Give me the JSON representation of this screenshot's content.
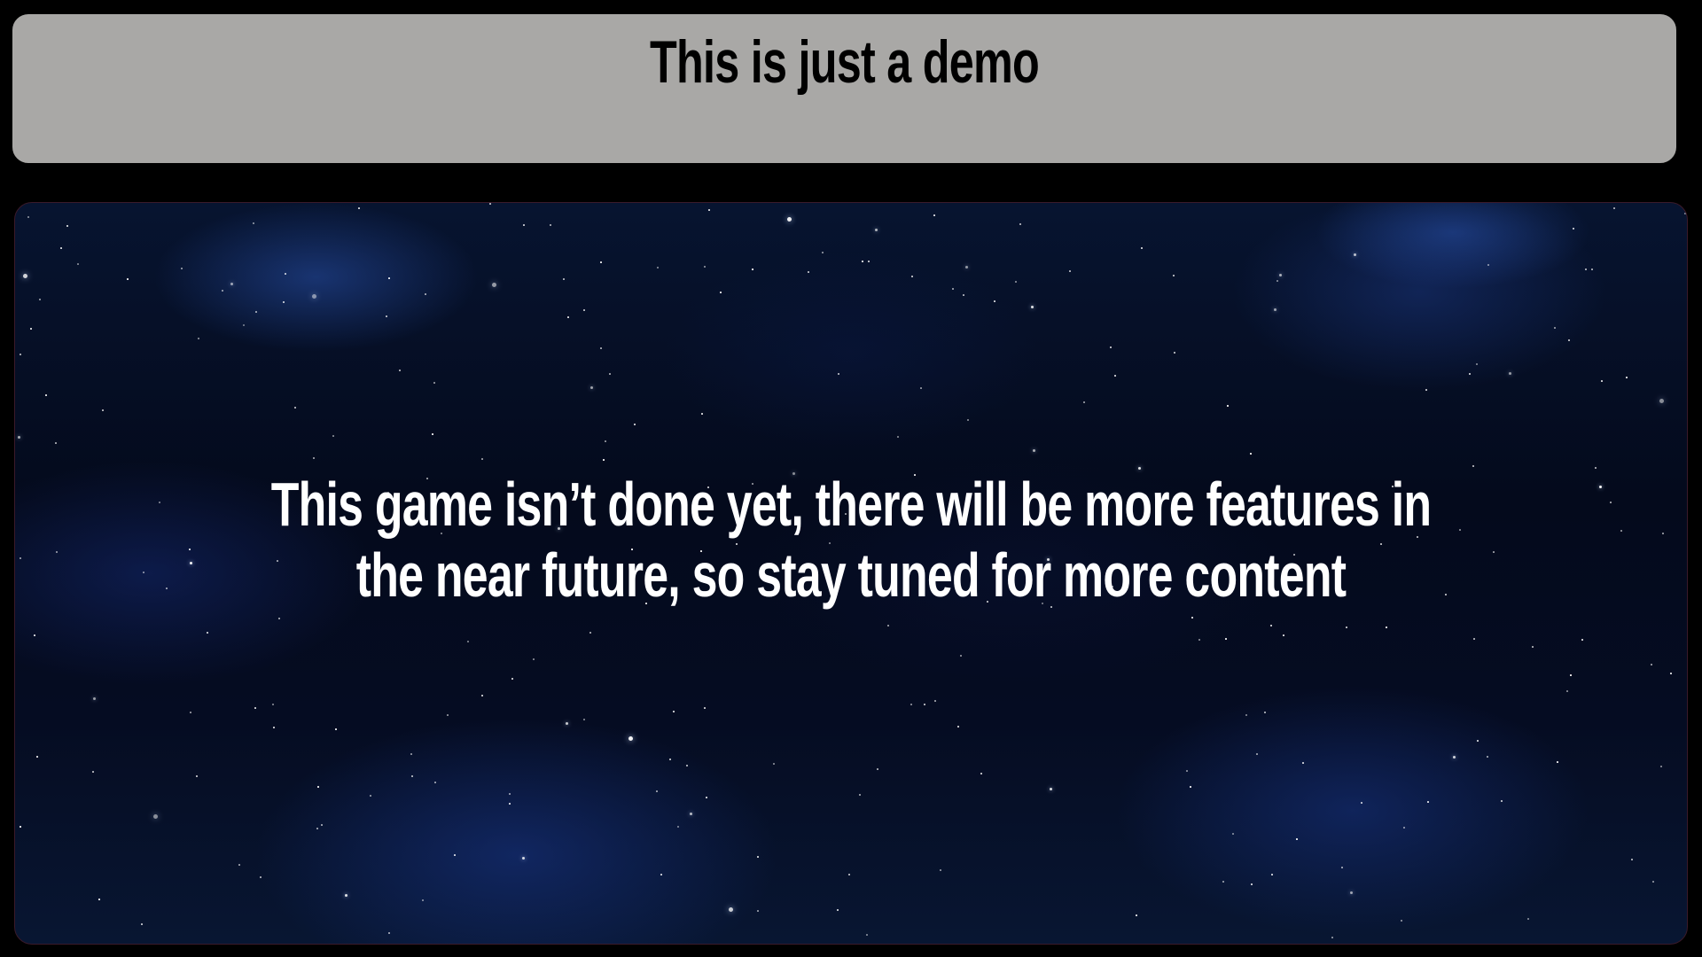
{
  "header": {
    "title": "This is just a demo"
  },
  "main": {
    "message": "This game isn’t done yet, there will be more features in the near future, so stay tuned for more content"
  },
  "colors": {
    "header_bg": "#a9a8a6",
    "frame": "#000000",
    "text_light": "#ffffff",
    "text_dark": "#000000",
    "space_bg": "#040a1c"
  }
}
